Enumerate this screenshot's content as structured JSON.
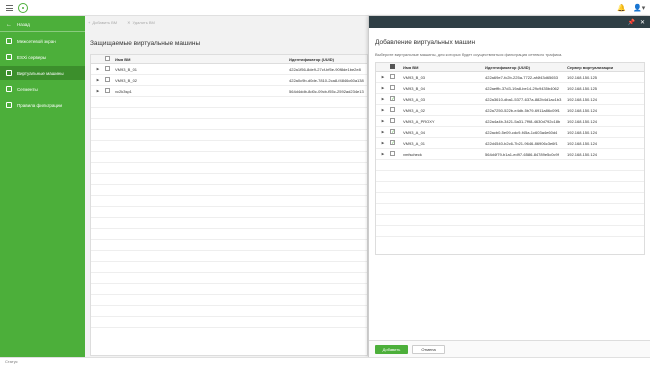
{
  "sidebar": {
    "back_label": "Назад",
    "items": [
      {
        "label": "Межсетевой экран"
      },
      {
        "label": "ESXi серверы"
      },
      {
        "label": "Виртуальные машины"
      },
      {
        "label": "Сегменты"
      },
      {
        "label": "Правила фильтрации"
      }
    ]
  },
  "toolbar": {
    "add_label": "Добавить ВМ",
    "delete_label": "Удалить ВМ"
  },
  "main": {
    "title": "Защищаемые виртуальные машины",
    "columns": [
      "Имя ВМ",
      "Идентификатор (UUID)"
    ],
    "rows": [
      {
        "name": "VM93_B_01",
        "uuid": "422a1f56-8de9-27cf-bf5e-90f8de1be2e8"
      },
      {
        "name": "VM93_B_02",
        "uuid": "422a0c9b-d0de-7810-2ca8-f4846c60a138"
      },
      {
        "name": "vc2k3sp1",
        "uuid": "564d4ddb-8d0c-09cb-f55c-2592ad234e13"
      }
    ]
  },
  "dialog": {
    "title": "Добавление виртуальных машин",
    "subtitle": "Выберите виртуальные машины, для которых будет осуществляться фильтрация сетевого трафика.",
    "columns": [
      "Имя ВМ",
      "Идентификатор (UUID)",
      "Сервер виртуализации"
    ],
    "rows": [
      {
        "name": "VM93_B_03",
        "uuid": "422a69e7-fc2b-225a-7722-af4f43d65653",
        "server": "192.168.150.125",
        "checked": false
      },
      {
        "name": "VM93_B_04",
        "uuid": "422aeffb-37d3-19a8-be14-29c9435b4062",
        "server": "192.168.150.125",
        "checked": false
      },
      {
        "name": "VM93_A_03",
        "uuid": "422a3610-dba1-5377-637a-882b4d1ac1b3",
        "server": "192.168.150.124",
        "checked": true
      },
      {
        "name": "VM93_A_02",
        "uuid": "422a7250-522b-e4db-5b79-6911a86c09f1",
        "server": "192.168.150.124",
        "checked": false
      },
      {
        "name": "VM93_A_PROXY",
        "uuid": "422a4a4b-3421-5a31-7f98-4630d792c18b",
        "server": "192.168.150.124",
        "checked": false
      },
      {
        "name": "VM93_A_04",
        "uuid": "422acb0-5e09-cdc9-f45a-1c603a4e60d4",
        "server": "192.168.150.124",
        "checked": true
      },
      {
        "name": "VM93_A_01",
        "uuid": "422d4540-b2c6-7b21-9646-86906c3e6f1",
        "server": "192.168.150.124",
        "checked": true
      },
      {
        "name": "vmfscheck",
        "uuid": "564d4f79-b1a1-ed97-6586-84789e5c0c9f",
        "server": "192.168.150.124",
        "checked": false
      }
    ],
    "ok_label": "Добавить",
    "cancel_label": "Отмена"
  },
  "status": {
    "text": "Статус"
  }
}
